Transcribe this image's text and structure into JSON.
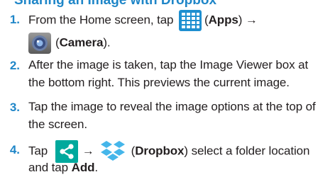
{
  "header_fragment": "Sharing an Image with Dropbox",
  "steps": [
    {
      "num": "1.",
      "line1": {
        "pre": "From the Home screen, tap ",
        "apps": "Apps",
        "arrow": "→"
      },
      "line2": {
        "camera": "Camera",
        "post": "."
      }
    },
    {
      "num": "2.",
      "line1": "After the image is taken, tap the Image Viewer box at",
      "line2": "the bottom right. This previews the current image."
    },
    {
      "num": "3.",
      "line1": "Tap the image to reveal the image options at the top of",
      "line2": "the screen."
    },
    {
      "num": "4.",
      "line1": {
        "pre": "Tap ",
        "arrow": "→",
        "dropbox": "Dropbox",
        "post": " select a folder location"
      },
      "line2": {
        "pre": "and tap ",
        "add": "Add",
        "post": "."
      }
    }
  ],
  "icons": {
    "apps": "apps-grid-icon",
    "camera": "camera-icon",
    "share": "share-icon",
    "dropbox": "dropbox-icon"
  },
  "colors": {
    "accent": "#1f86c8",
    "text": "#231f20",
    "apps_icon": "#1e8fd0",
    "share_icon": "#00a99d",
    "dropbox": "#45b6ea"
  }
}
